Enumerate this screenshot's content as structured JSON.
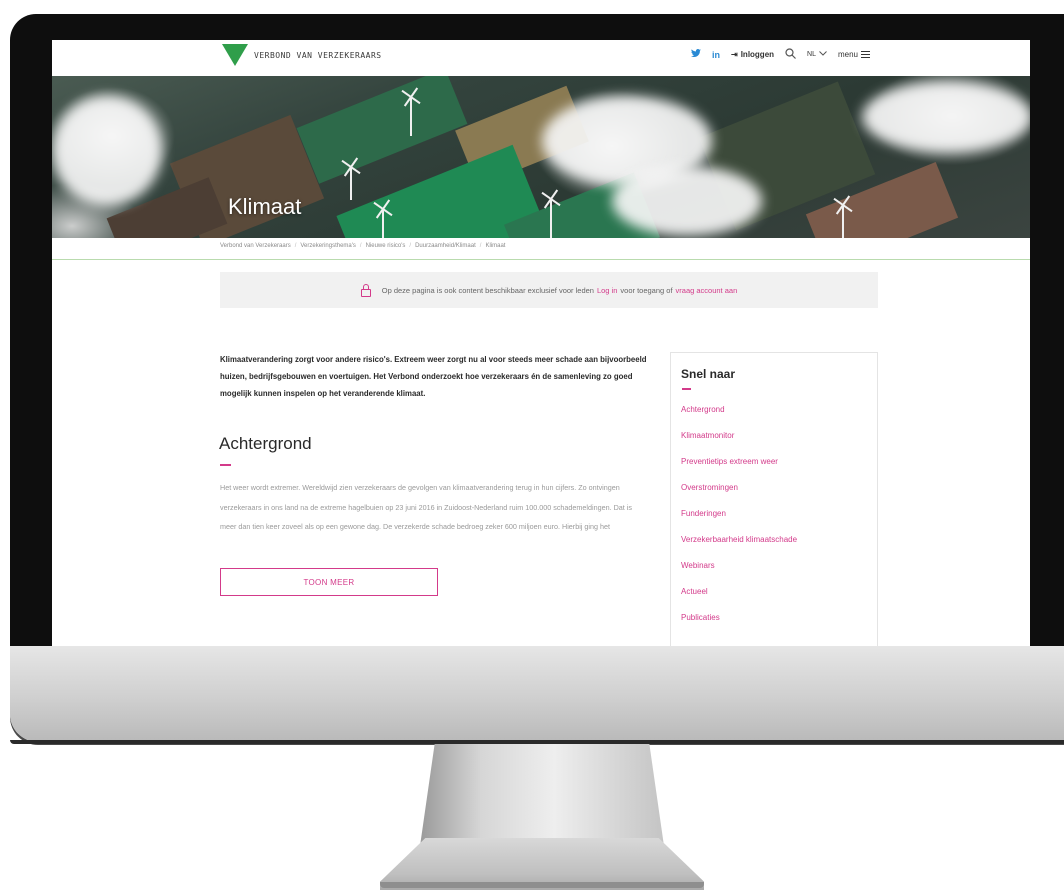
{
  "header": {
    "logo_text": "VERBOND VAN VERZEKERAARS",
    "twitter": "✓",
    "linkedin": "in",
    "login_label": "Inloggen",
    "lang_label": "NL",
    "menu_label": "menu"
  },
  "hero": {
    "title": "Klimaat"
  },
  "breadcrumb": [
    "Verbond van Verzekeraars",
    "Verzekeringsthema's",
    "Nieuwe risico's",
    "Duurzaamheid/Klimaat",
    "Klimaat"
  ],
  "notice": {
    "text_before": "Op deze pagina is ook content beschikbaar exclusief voor leden",
    "login_link": "Log in",
    "text_middle": "voor toegang of",
    "request_link": "vraag account aan"
  },
  "intro": "Klimaatverandering zorgt voor andere risico's. Extreem weer zorgt nu al voor steeds meer schade aan bijvoorbeeld huizen, bedrijfsgebouwen en voertuigen. Het Verbond onderzoekt hoe verzekeraars én de samenleving zo goed mogelijk kunnen inspelen op het veranderende klimaat.",
  "section": {
    "heading": "Achtergrond",
    "body": "Het weer wordt extremer. Wereldwijd zien verzekeraars de gevolgen van klimaatverandering terug in hun cijfers. Zo ontvingen verzekeraars in ons land na de extreme hagelbuien op 23 juni 2016 in Zuidoost-Nederland ruim 100.000 schademeldingen. Dat is meer dan tien keer zoveel als op een gewone dag. De verzekerde schade bedroeg zeker 600 miljoen euro. Hierbij ging het",
    "button_label": "TOON MEER"
  },
  "sidebar": {
    "title": "Snel naar",
    "links": [
      "Achtergrond",
      "Klimaatmonitor",
      "Preventietips extreem weer",
      "Overstromingen",
      "Funderingen",
      "Verzekerbaarheid klimaatschade",
      "Webinars",
      "Actueel",
      "Publicaties"
    ]
  },
  "colors": {
    "accent": "#d33a8a",
    "brand_green": "#2f9e4a"
  }
}
